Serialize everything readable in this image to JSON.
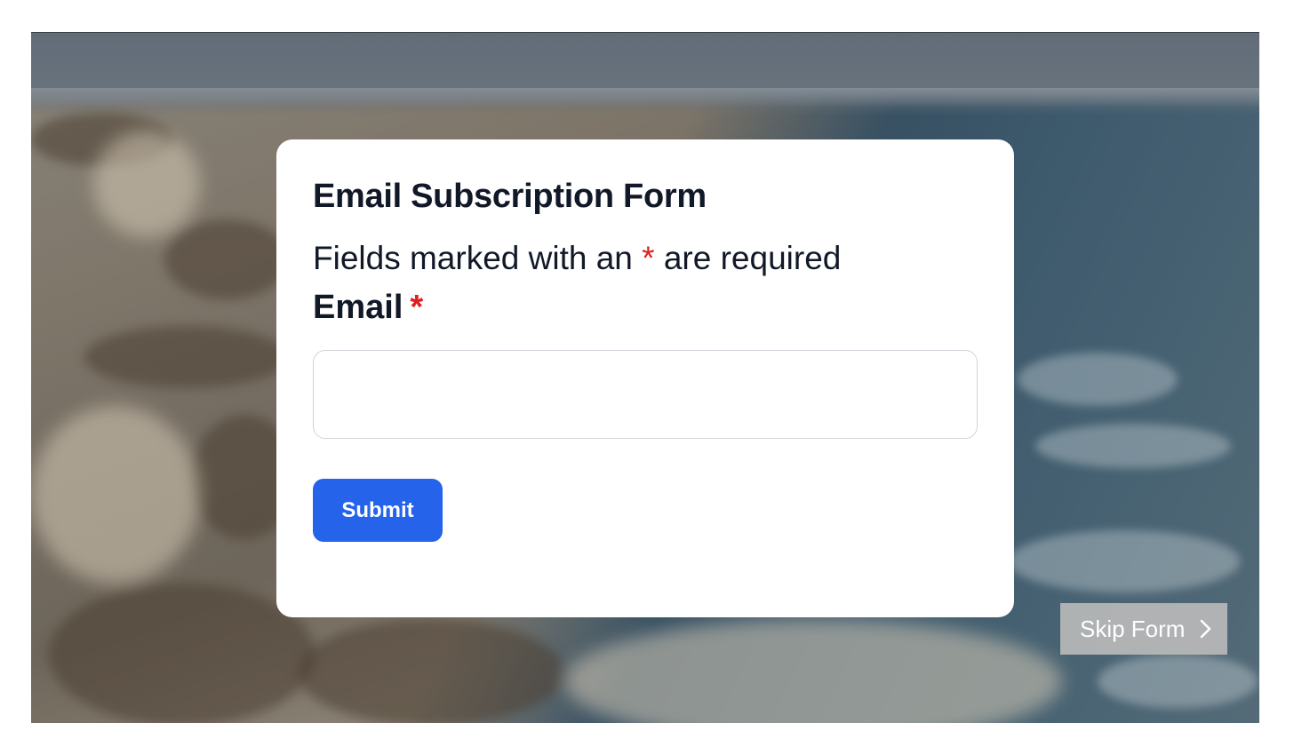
{
  "form": {
    "title": "Email Subscription Form",
    "note_prefix": "Fields marked with an",
    "note_asterisk": "*",
    "note_suffix": "are required",
    "email_label": "Email",
    "email_required_marker": "*",
    "email_value": "",
    "submit_label": "Submit"
  },
  "skip": {
    "label": "Skip Form",
    "icon": "chevron-right-icon"
  },
  "colors": {
    "accent": "#2563eb",
    "required": "#e11d1d",
    "text": "#111827"
  }
}
